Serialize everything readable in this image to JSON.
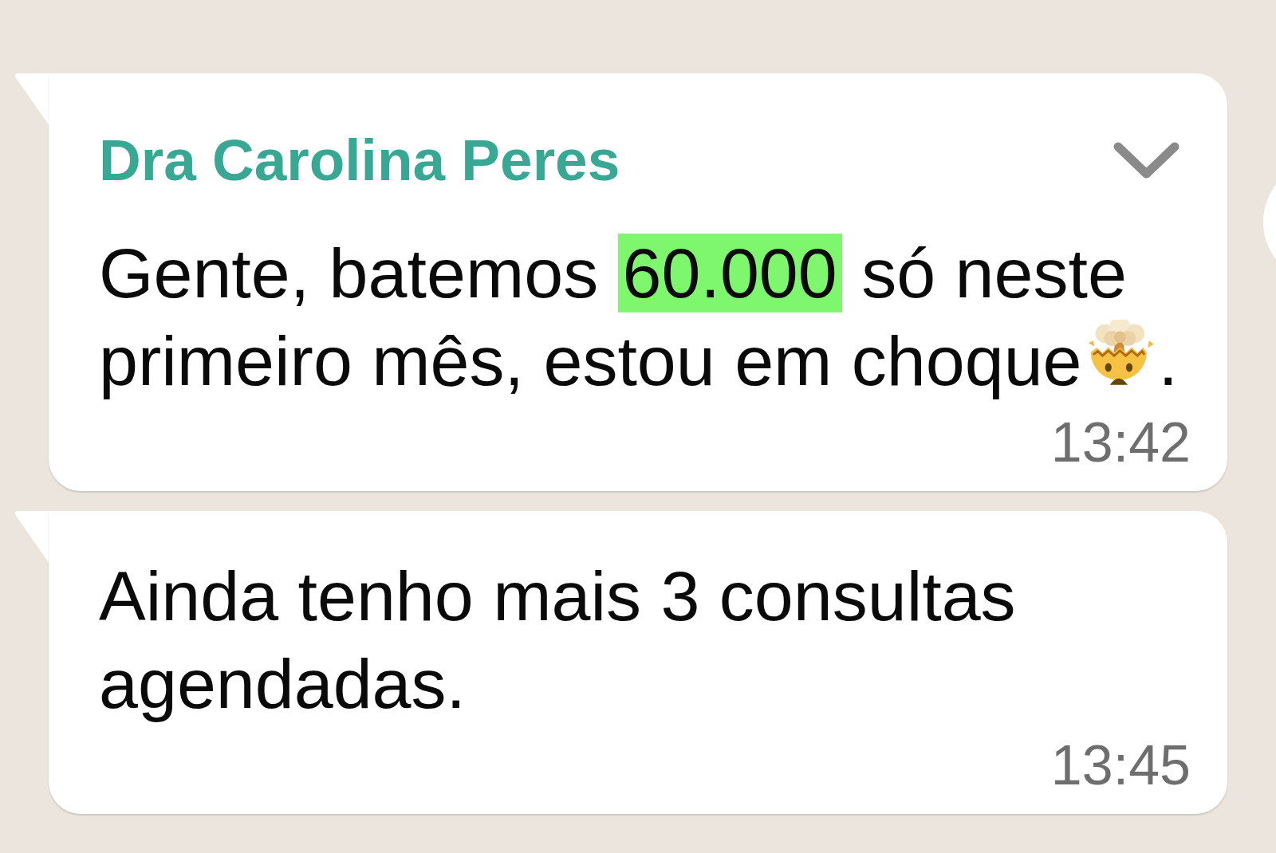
{
  "messages": [
    {
      "sender": "Dra Carolina Peres",
      "menu_chevron": true,
      "side_button": true,
      "parts": [
        {
          "kind": "text",
          "text": "Gente, batemos "
        },
        {
          "kind": "highlight",
          "text": "60.000"
        },
        {
          "kind": "text",
          "text": " só neste primeiro mês, estou em choque"
        },
        {
          "kind": "emoji"
        },
        {
          "kind": "text",
          "text": "."
        }
      ],
      "time": "13:42"
    },
    {
      "menu_chevron": false,
      "side_button": false,
      "parts": [
        {
          "kind": "text",
          "text": "Ainda tenho mais 3 consultas agendadas."
        }
      ],
      "time": "13:45"
    }
  ]
}
